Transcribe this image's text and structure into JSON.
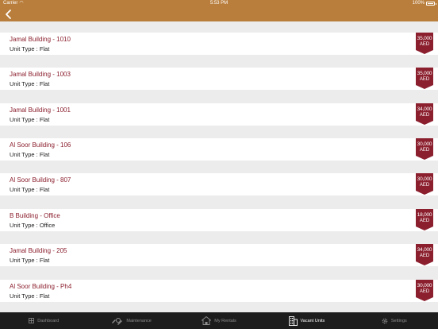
{
  "status": {
    "carrier": "Carrier",
    "time": "5:53 PM",
    "battery": "100%"
  },
  "nav": {
    "back_icon": "chevron-left-icon"
  },
  "units": [
    {
      "name": "Jamal Building - 1010",
      "unit_type_label": "Unit Type :",
      "unit_type": "Flat",
      "price": "35,000",
      "currency": "AED"
    },
    {
      "name": "Jamal Building - 1003",
      "unit_type_label": "Unit Type :",
      "unit_type": "Flat",
      "price": "35,000",
      "currency": "AED"
    },
    {
      "name": "Jamal Building - 1001",
      "unit_type_label": "Unit Type :",
      "unit_type": "Flat",
      "price": "34,000",
      "currency": "AED"
    },
    {
      "name": "Al Soor Building - 106",
      "unit_type_label": "Unit Type :",
      "unit_type": "Flat",
      "price": "30,000",
      "currency": "AED"
    },
    {
      "name": "Al Soor Building - 807",
      "unit_type_label": "Unit Type :",
      "unit_type": "Flat",
      "price": "30,000",
      "currency": "AED"
    },
    {
      "name": "B Building - Office",
      "unit_type_label": "Unit Type :",
      "unit_type": "Office",
      "price": "18,000",
      "currency": "AED"
    },
    {
      "name": "Jamal Building - 205",
      "unit_type_label": "Unit Type :",
      "unit_type": "Flat",
      "price": "34,000",
      "currency": "AED"
    },
    {
      "name": "Al Soor Building - Ph4",
      "unit_type_label": "Unit Type :",
      "unit_type": "Flat",
      "price": "30,000",
      "currency": "AED"
    }
  ],
  "tabs": [
    {
      "label": "Dashboard",
      "icon": "dashboard-icon",
      "active": false
    },
    {
      "label": "Maintenance",
      "icon": "maintenance-icon",
      "active": false
    },
    {
      "label": "My Rentals",
      "icon": "house-icon",
      "active": false
    },
    {
      "label": "Vacant Units",
      "icon": "building-icon",
      "active": true
    },
    {
      "label": "Settings",
      "icon": "gear-icon",
      "active": false
    }
  ],
  "colors": {
    "brand": "#b97e3c",
    "accent": "#8b1f2e",
    "tab_bar": "#1d1d1d"
  }
}
